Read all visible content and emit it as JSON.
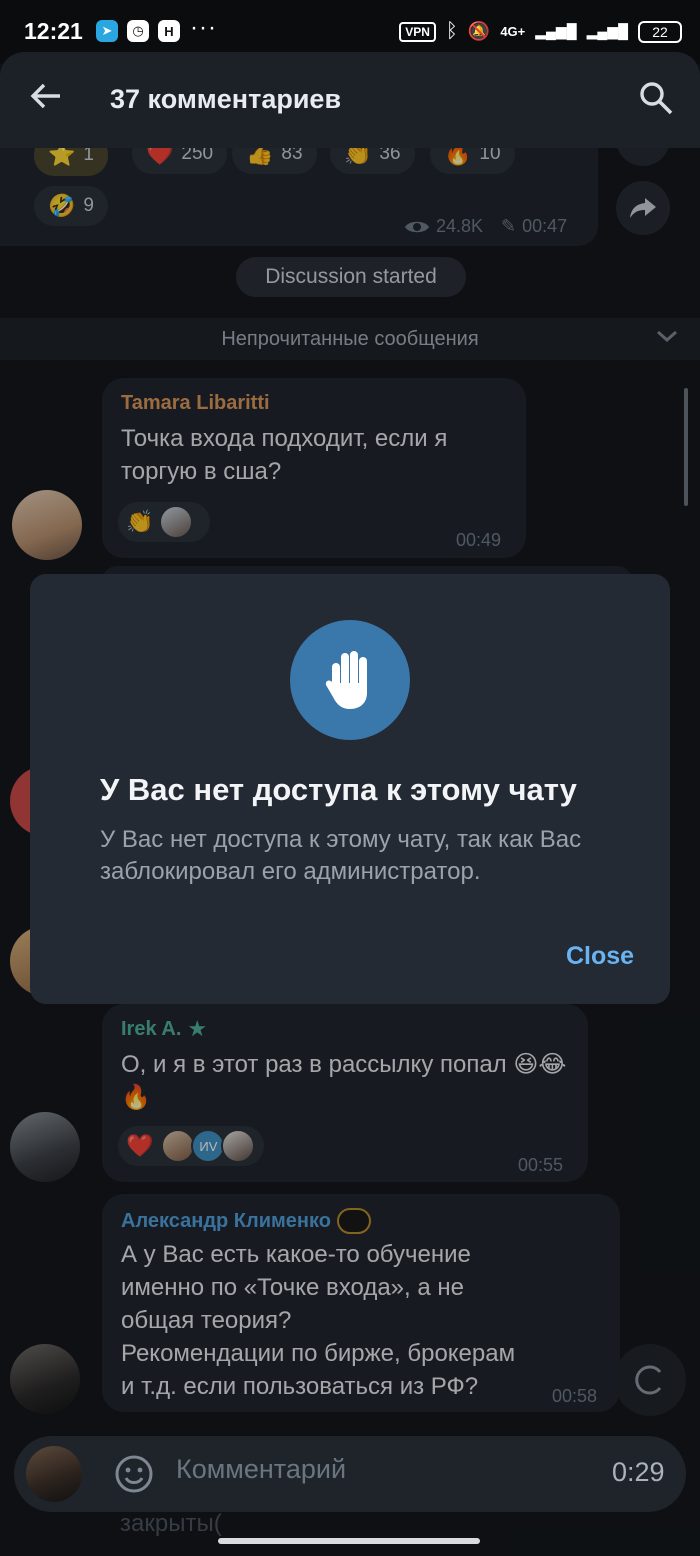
{
  "status_bar": {
    "time": "12:21",
    "app_icons": [
      "telegram-icon",
      "clock-app-icon",
      "n-app-icon"
    ],
    "more": "···",
    "vpn": "VPN",
    "network": "4G+",
    "battery": "22"
  },
  "header": {
    "title": "37 комментариев"
  },
  "post": {
    "reactions": [
      {
        "emoji": "⭐",
        "count": "1",
        "mine": true
      },
      {
        "emoji": "❤️",
        "count": "250"
      },
      {
        "emoji": "👍",
        "count": "83"
      },
      {
        "emoji": "👏",
        "count": "36"
      },
      {
        "emoji": "🔥",
        "count": "10"
      },
      {
        "emoji": "🤣",
        "count": "9"
      }
    ],
    "views": "24.8K",
    "time": "00:47"
  },
  "service": {
    "discussion_started": "Discussion started",
    "unread": "Непрочитанные сообщения"
  },
  "messages": [
    {
      "sender": "Tamara Libaritti",
      "sender_color": "#d9965b",
      "text": "Точка входа подходит, если я торгую в сша?",
      "time": "00:49"
    },
    {
      "sender": "Irek A.",
      "sender_color": "#4fae9a",
      "text": "О, и я в этот раз в рассылку попал 😆😂🔥",
      "mini_avatar_text": "ИV",
      "time": "00:55"
    },
    {
      "sender": "Александр Клименко",
      "sender_color": "#4f9ed8",
      "text_lines": [
        "А у Вас есть какое-то обучение",
        "именно по «Точке входа», а не",
        "общая теория?",
        "Рекомендации по бирже, брокерам",
        "и т.д. если пользоваться из РФ?"
      ],
      "time": "00:58"
    }
  ],
  "modal": {
    "icon": "hand-stop-icon",
    "title": "У Вас нет доступа к этому чату",
    "body": "У Вас нет доступа к этому чату, так как Вас заблокировал его администратор.",
    "close_label": "Close"
  },
  "input": {
    "placeholder": "Комментарий",
    "timer": "0:29",
    "behind_text": "закрыты("
  },
  "colors": {
    "accent": "#6ab3f3",
    "modal_icon_bg": "#3a77aa"
  }
}
